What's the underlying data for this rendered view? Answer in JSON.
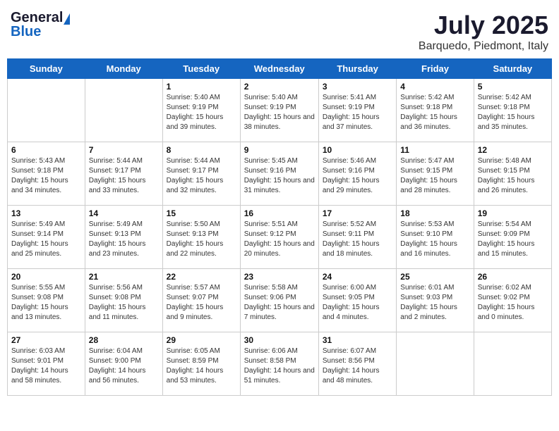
{
  "header": {
    "logo_general": "General",
    "logo_blue": "Blue",
    "month_title": "July 2025",
    "location": "Barquedo, Piedmont, Italy"
  },
  "weekdays": [
    "Sunday",
    "Monday",
    "Tuesday",
    "Wednesday",
    "Thursday",
    "Friday",
    "Saturday"
  ],
  "weeks": [
    [
      {
        "day": "",
        "detail": ""
      },
      {
        "day": "",
        "detail": ""
      },
      {
        "day": "1",
        "detail": "Sunrise: 5:40 AM\nSunset: 9:19 PM\nDaylight: 15 hours and 39 minutes."
      },
      {
        "day": "2",
        "detail": "Sunrise: 5:40 AM\nSunset: 9:19 PM\nDaylight: 15 hours and 38 minutes."
      },
      {
        "day": "3",
        "detail": "Sunrise: 5:41 AM\nSunset: 9:19 PM\nDaylight: 15 hours and 37 minutes."
      },
      {
        "day": "4",
        "detail": "Sunrise: 5:42 AM\nSunset: 9:18 PM\nDaylight: 15 hours and 36 minutes."
      },
      {
        "day": "5",
        "detail": "Sunrise: 5:42 AM\nSunset: 9:18 PM\nDaylight: 15 hours and 35 minutes."
      }
    ],
    [
      {
        "day": "6",
        "detail": "Sunrise: 5:43 AM\nSunset: 9:18 PM\nDaylight: 15 hours and 34 minutes."
      },
      {
        "day": "7",
        "detail": "Sunrise: 5:44 AM\nSunset: 9:17 PM\nDaylight: 15 hours and 33 minutes."
      },
      {
        "day": "8",
        "detail": "Sunrise: 5:44 AM\nSunset: 9:17 PM\nDaylight: 15 hours and 32 minutes."
      },
      {
        "day": "9",
        "detail": "Sunrise: 5:45 AM\nSunset: 9:16 PM\nDaylight: 15 hours and 31 minutes."
      },
      {
        "day": "10",
        "detail": "Sunrise: 5:46 AM\nSunset: 9:16 PM\nDaylight: 15 hours and 29 minutes."
      },
      {
        "day": "11",
        "detail": "Sunrise: 5:47 AM\nSunset: 9:15 PM\nDaylight: 15 hours and 28 minutes."
      },
      {
        "day": "12",
        "detail": "Sunrise: 5:48 AM\nSunset: 9:15 PM\nDaylight: 15 hours and 26 minutes."
      }
    ],
    [
      {
        "day": "13",
        "detail": "Sunrise: 5:49 AM\nSunset: 9:14 PM\nDaylight: 15 hours and 25 minutes."
      },
      {
        "day": "14",
        "detail": "Sunrise: 5:49 AM\nSunset: 9:13 PM\nDaylight: 15 hours and 23 minutes."
      },
      {
        "day": "15",
        "detail": "Sunrise: 5:50 AM\nSunset: 9:13 PM\nDaylight: 15 hours and 22 minutes."
      },
      {
        "day": "16",
        "detail": "Sunrise: 5:51 AM\nSunset: 9:12 PM\nDaylight: 15 hours and 20 minutes."
      },
      {
        "day": "17",
        "detail": "Sunrise: 5:52 AM\nSunset: 9:11 PM\nDaylight: 15 hours and 18 minutes."
      },
      {
        "day": "18",
        "detail": "Sunrise: 5:53 AM\nSunset: 9:10 PM\nDaylight: 15 hours and 16 minutes."
      },
      {
        "day": "19",
        "detail": "Sunrise: 5:54 AM\nSunset: 9:09 PM\nDaylight: 15 hours and 15 minutes."
      }
    ],
    [
      {
        "day": "20",
        "detail": "Sunrise: 5:55 AM\nSunset: 9:08 PM\nDaylight: 15 hours and 13 minutes."
      },
      {
        "day": "21",
        "detail": "Sunrise: 5:56 AM\nSunset: 9:08 PM\nDaylight: 15 hours and 11 minutes."
      },
      {
        "day": "22",
        "detail": "Sunrise: 5:57 AM\nSunset: 9:07 PM\nDaylight: 15 hours and 9 minutes."
      },
      {
        "day": "23",
        "detail": "Sunrise: 5:58 AM\nSunset: 9:06 PM\nDaylight: 15 hours and 7 minutes."
      },
      {
        "day": "24",
        "detail": "Sunrise: 6:00 AM\nSunset: 9:05 PM\nDaylight: 15 hours and 4 minutes."
      },
      {
        "day": "25",
        "detail": "Sunrise: 6:01 AM\nSunset: 9:03 PM\nDaylight: 15 hours and 2 minutes."
      },
      {
        "day": "26",
        "detail": "Sunrise: 6:02 AM\nSunset: 9:02 PM\nDaylight: 15 hours and 0 minutes."
      }
    ],
    [
      {
        "day": "27",
        "detail": "Sunrise: 6:03 AM\nSunset: 9:01 PM\nDaylight: 14 hours and 58 minutes."
      },
      {
        "day": "28",
        "detail": "Sunrise: 6:04 AM\nSunset: 9:00 PM\nDaylight: 14 hours and 56 minutes."
      },
      {
        "day": "29",
        "detail": "Sunrise: 6:05 AM\nSunset: 8:59 PM\nDaylight: 14 hours and 53 minutes."
      },
      {
        "day": "30",
        "detail": "Sunrise: 6:06 AM\nSunset: 8:58 PM\nDaylight: 14 hours and 51 minutes."
      },
      {
        "day": "31",
        "detail": "Sunrise: 6:07 AM\nSunset: 8:56 PM\nDaylight: 14 hours and 48 minutes."
      },
      {
        "day": "",
        "detail": ""
      },
      {
        "day": "",
        "detail": ""
      }
    ]
  ]
}
